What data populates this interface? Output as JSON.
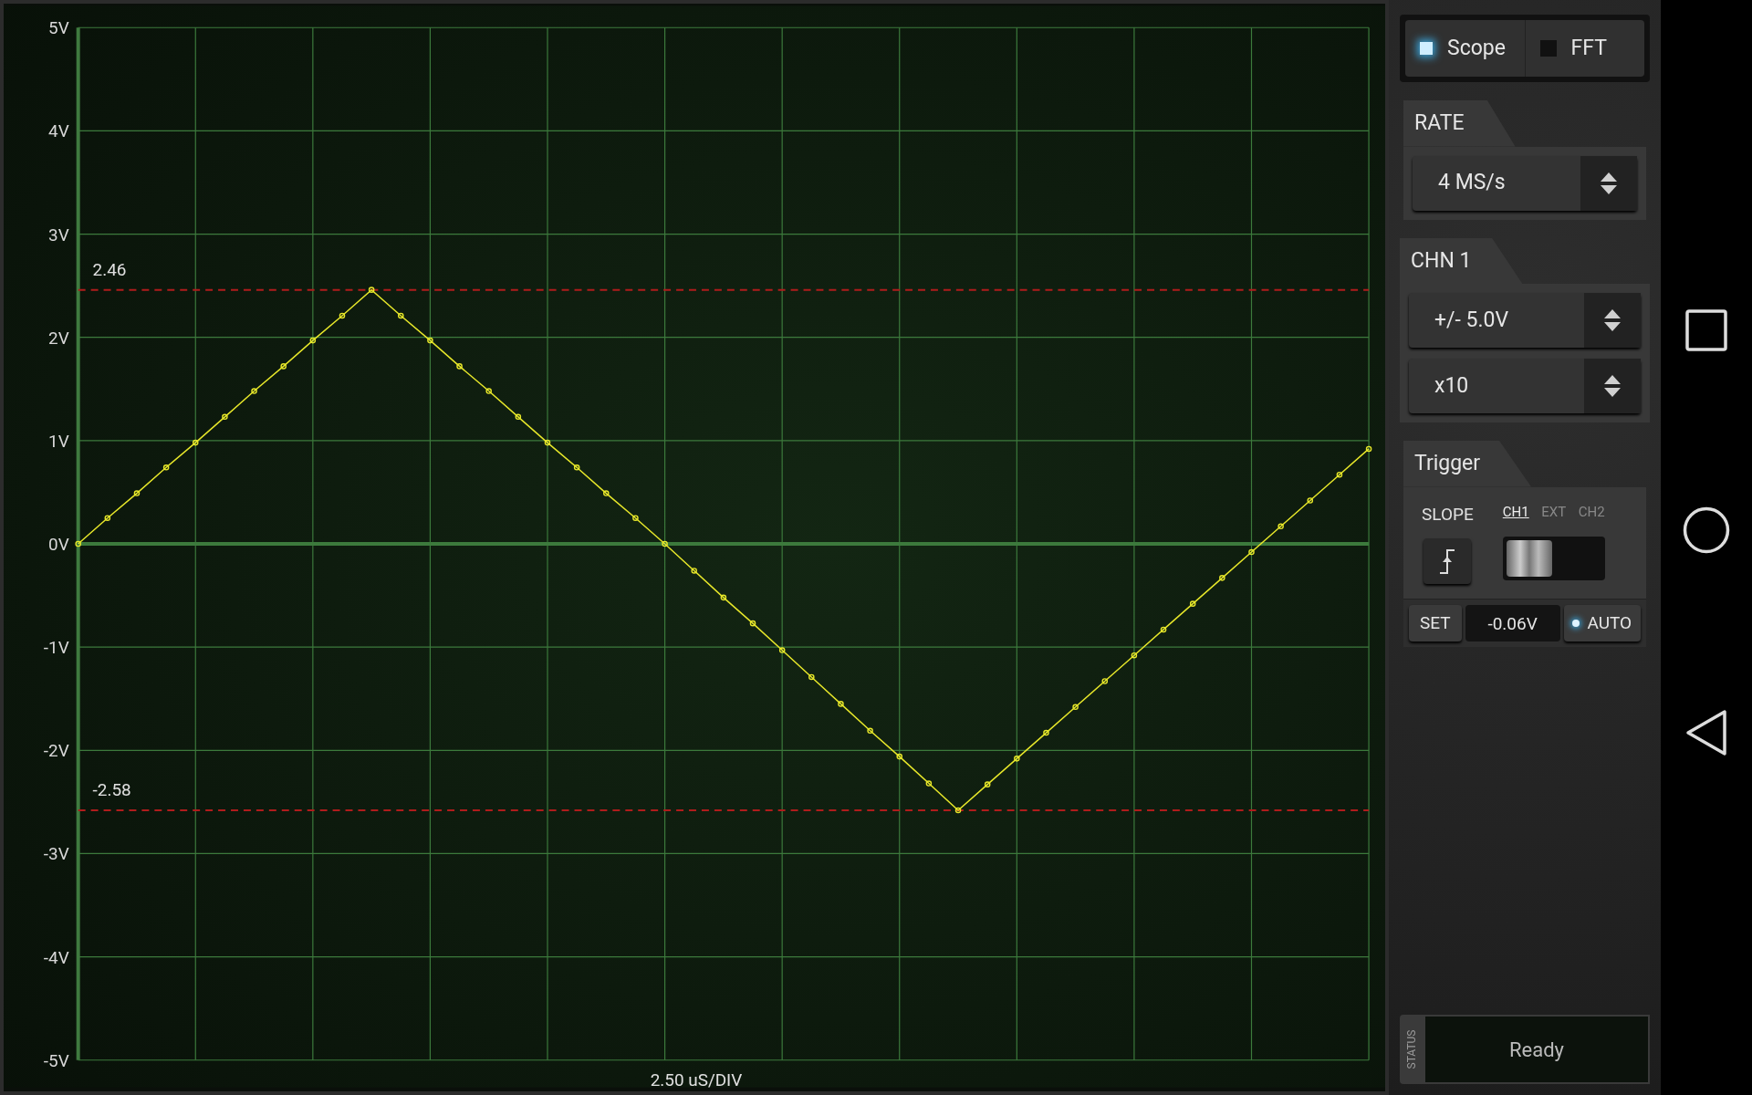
{
  "scope": {
    "chart_data": {
      "type": "line",
      "xlabel": "2.50 uS/DIV",
      "categories": [
        null,
        null,
        null,
        null,
        null,
        null,
        null,
        null,
        null,
        null,
        null,
        null,
        null,
        null,
        null,
        null,
        null,
        null,
        null,
        null,
        null,
        null,
        null,
        null,
        null,
        null,
        null,
        null,
        null,
        null,
        null,
        null,
        null,
        null,
        null,
        null,
        null,
        null,
        null,
        null,
        null,
        null,
        null,
        null,
        null
      ],
      "grid": true,
      "series": [
        {
          "color": "#e8e82a",
          "marker": "o",
          "values": [
            0,
            0.25,
            0.49,
            0.74,
            0.98,
            1.23,
            1.48,
            1.72,
            1.97,
            2.21,
            2.46,
            2.21,
            1.97,
            1.72,
            1.48,
            1.23,
            0.98,
            0.74,
            0.49,
            0.25,
            0,
            -0.26,
            -0.52,
            -0.77,
            -1.03,
            -1.29,
            -1.55,
            -1.81,
            -2.06,
            -2.32,
            -2.58,
            -2.33,
            -2.08,
            -1.83,
            -1.58,
            -1.33,
            -1.08,
            -0.83,
            -0.58,
            -0.33,
            -0.08,
            0.17,
            0.42,
            0.67,
            0.92
          ]
        }
      ],
      "ylim": [
        -5,
        5
      ],
      "yticks": [
        {
          "value": 5,
          "label": "5V"
        },
        {
          "value": 4,
          "label": "4V"
        },
        {
          "value": 3,
          "label": "3V"
        },
        {
          "value": 2,
          "label": "2V"
        },
        {
          "value": 1,
          "label": "1V"
        },
        {
          "value": 0,
          "label": "0V"
        },
        {
          "value": -1,
          "label": "-1V"
        },
        {
          "value": -2,
          "label": "-2V"
        },
        {
          "value": -3,
          "label": "-3V"
        },
        {
          "value": -4,
          "label": "-4V"
        },
        {
          "value": -5,
          "label": "-5V"
        }
      ],
      "ref_lines": [
        {
          "axis": "y",
          "value": 0,
          "color": "#3c7a3c"
        },
        {
          "axis": "y",
          "value": 2.46,
          "label": "2.46",
          "color": "#b01c1c"
        },
        {
          "axis": "y",
          "value": -2.58,
          "label": "-2.58",
          "color": "#b01c1c"
        }
      ]
    }
  },
  "mode_tabs": [
    {
      "label": "Scope",
      "selected": true
    },
    {
      "label": "FFT",
      "selected": false
    }
  ],
  "rate": {
    "title": "RATE",
    "value": "4 MS/s"
  },
  "channel": {
    "title": "CHN 1",
    "range": "+/- 5.0V",
    "probe": "x10"
  },
  "trigger": {
    "title": "Trigger",
    "slope_label": "SLOPE",
    "sources": [
      {
        "label": "CH1",
        "selected": true
      },
      {
        "label": "EXT",
        "selected": false
      },
      {
        "label": "CH2",
        "selected": false
      }
    ],
    "set_label": "SET",
    "level": "-0.06V",
    "auto": {
      "label": "AUTO",
      "on": true
    }
  },
  "status": {
    "label": "STATUS",
    "text": "Ready"
  }
}
